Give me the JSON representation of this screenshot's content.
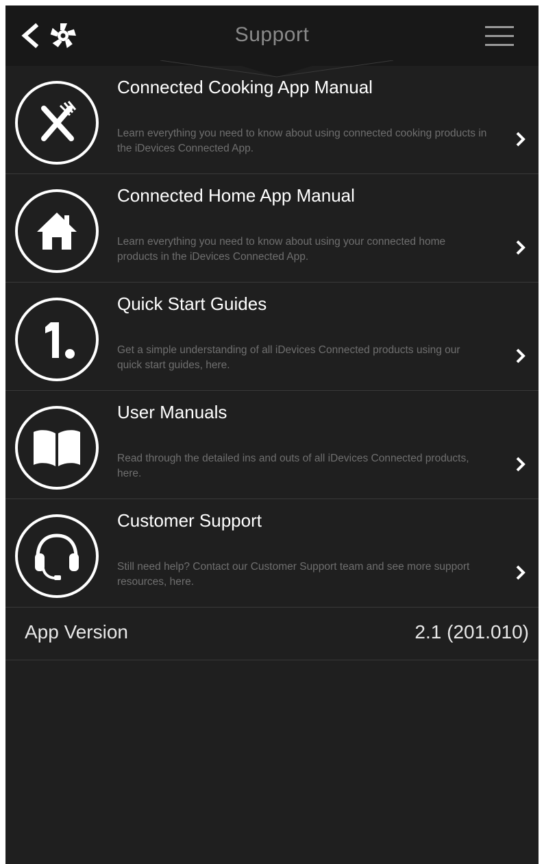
{
  "header": {
    "title": "Support",
    "back_icon": "chevron-left-icon",
    "logo_icon": "idevices-logo-icon",
    "menu_icon": "hamburger-menu-icon"
  },
  "items": [
    {
      "title": "Connected Cooking App Manual",
      "description": "Learn everything you need to know about using connected cooking products in the iDevices Connected App.",
      "icon": "fork-knife-icon"
    },
    {
      "title": "Connected Home App Manual",
      "description": "Learn everything you need to know about using your connected home products in the iDevices Connected App.",
      "icon": "home-icon"
    },
    {
      "title": "Quick Start Guides",
      "description": "Get a simple understanding of all iDevices Connected products using our quick start guides, here.",
      "icon": "number-one-icon"
    },
    {
      "title": "User Manuals",
      "description": "Read through the detailed ins and outs of all iDevices Connected products, here.",
      "icon": "book-icon"
    },
    {
      "title": "Customer Support",
      "description": "Still need help? Contact our Customer Support team and see more support resources, here.",
      "icon": "headset-icon"
    }
  ],
  "version": {
    "label": "App Version",
    "value": "2.1 (201.010)"
  },
  "colors": {
    "background": "#1f1f1f",
    "header": "#181818",
    "text": "#ffffff",
    "muted": "#6f6f6f",
    "divider": "#3a3a3a"
  }
}
